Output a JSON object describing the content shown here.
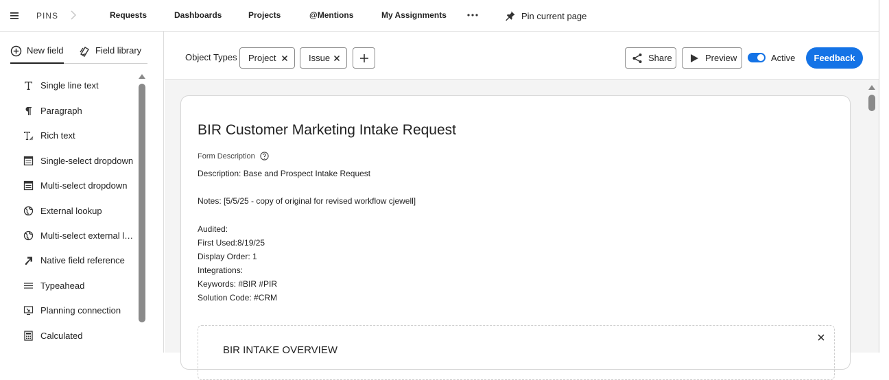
{
  "topbar": {
    "brand": "PINS",
    "nav": [
      "Requests",
      "Dashboards",
      "Projects",
      "@Mentions",
      "My Assignments"
    ],
    "pin_label": "Pin current page"
  },
  "left_panel": {
    "tabs": [
      {
        "label": "New field",
        "icon": "plus-circle-icon",
        "active": true
      },
      {
        "label": "Field library",
        "icon": "library-icon",
        "active": false
      }
    ],
    "fields": [
      {
        "label": "Single line text",
        "icon": "text-icon"
      },
      {
        "label": "Paragraph",
        "icon": "pilcrow-icon"
      },
      {
        "label": "Rich text",
        "icon": "rich-text-icon"
      },
      {
        "label": "Single-select dropdown",
        "icon": "dropdown-icon"
      },
      {
        "label": "Multi-select dropdown",
        "icon": "dropdown-icon"
      },
      {
        "label": "External lookup",
        "icon": "globe-icon"
      },
      {
        "label": "Multi-select external lo...",
        "icon": "globe-icon"
      },
      {
        "label": "Native field reference",
        "icon": "arrow-icon"
      },
      {
        "label": "Typeahead",
        "icon": "lines-icon"
      },
      {
        "label": "Planning connection",
        "icon": "connection-icon"
      },
      {
        "label": "Calculated",
        "icon": "calculator-icon"
      }
    ]
  },
  "toolbar": {
    "object_types_label": "Object Types",
    "chips": [
      "Project",
      "Issue"
    ],
    "share_label": "Share",
    "preview_label": "Preview",
    "active_label": "Active",
    "active_on": true,
    "feedback_label": "Feedback",
    "accent_color": "#1473e6"
  },
  "form": {
    "title": "BIR Customer Marketing Intake Request",
    "description_label": "Form Description",
    "description_lines": [
      "Description: Base and Prospect Intake Request",
      "",
      "Notes: [5/5/25 - copy of original for revised workflow cjewell]",
      "",
      "Audited:",
      "First Used:8/19/25",
      "Display Order: 1",
      "Integrations:",
      "Keywords: #BIR #PIR",
      "Solution Code: #CRM"
    ],
    "section_title": "BIR INTAKE OVERVIEW"
  }
}
